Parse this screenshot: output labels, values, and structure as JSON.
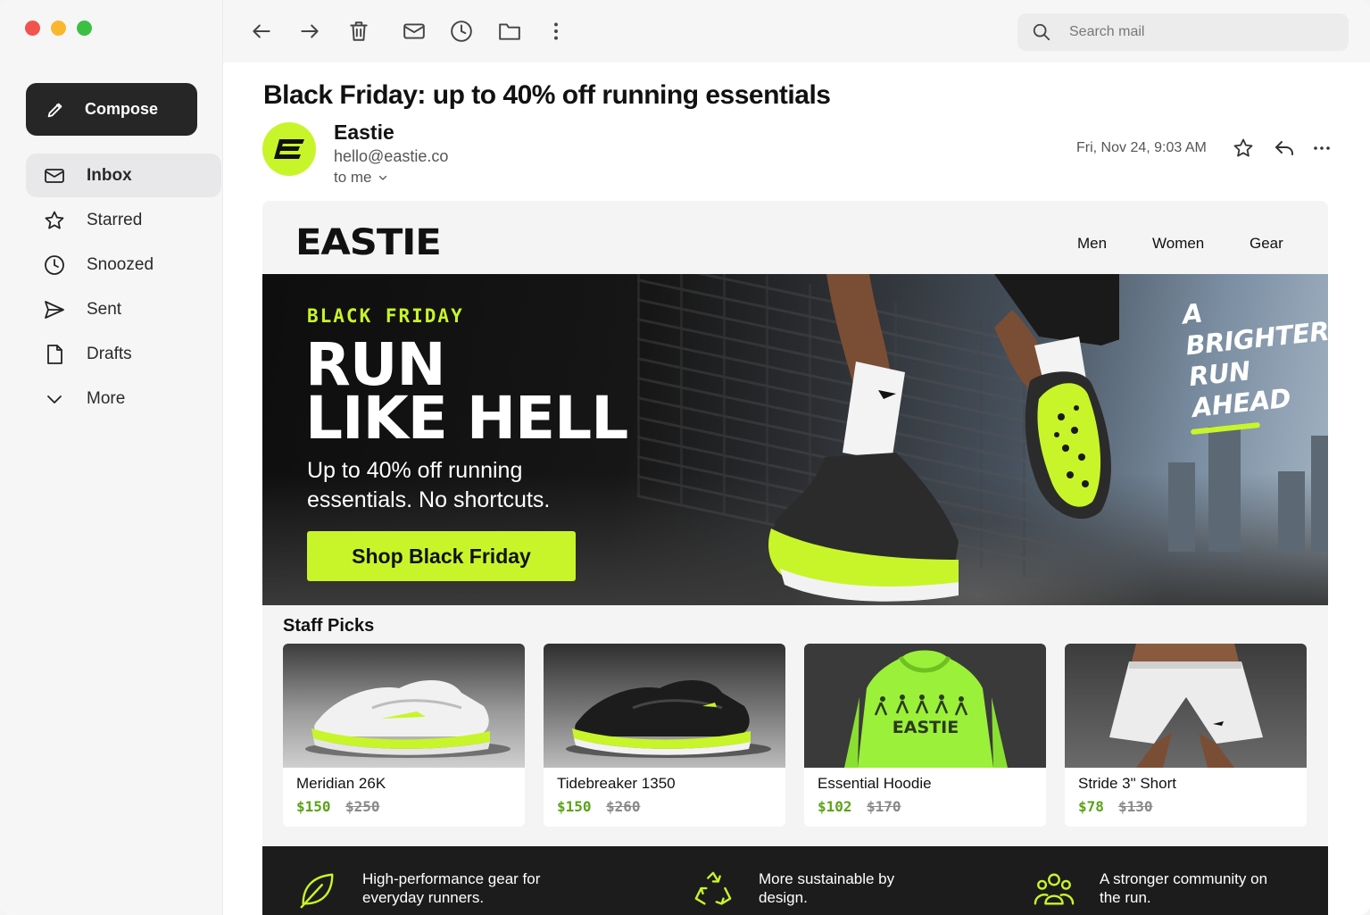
{
  "sidebar": {
    "compose_label": "Compose",
    "items": [
      {
        "label": "Inbox",
        "icon": "inbox-icon"
      },
      {
        "label": "Starred",
        "icon": "star-icon"
      },
      {
        "label": "Snoozed",
        "icon": "clock-icon"
      },
      {
        "label": "Sent",
        "icon": "send-icon"
      },
      {
        "label": "Drafts",
        "icon": "draft-icon"
      },
      {
        "label": "More",
        "icon": "chevron-down-icon"
      }
    ]
  },
  "toolbar": {
    "icons": [
      "back-arrow-icon",
      "forward-arrow-icon",
      "trash-icon",
      "mail-icon",
      "clock-icon",
      "folder-icon",
      "more-vert-icon"
    ],
    "search_placeholder": "Search mail"
  },
  "message": {
    "subject": "Black Friday: up to 40% off running essentials",
    "sender_name": "Eastie",
    "sender_email": "hello@eastie.co",
    "recipient": "to me",
    "date": "Fri, Nov 24, 9:03 AM",
    "avatar_letter": "E"
  },
  "email": {
    "brand": "EASTIE",
    "nav": [
      "Men",
      "Women",
      "Gear"
    ],
    "hero": {
      "eyebrow": "BLACK FRIDAY",
      "headline_line1": "RUN",
      "headline_line2": "LIKE HELL",
      "subhead": "Up to 40% off running essentials. No shortcuts.",
      "cta": "Shop Black Friday",
      "tagline_lines": [
        "A",
        "BRIGHTER",
        "RUN",
        "AHEAD"
      ]
    },
    "picks_title": "Staff Picks",
    "products": [
      {
        "name": "Meridian 26K",
        "price": "$150",
        "was": "$250"
      },
      {
        "name": "Tidebreaker 1350",
        "price": "$150",
        "was": "$260"
      },
      {
        "name": "Essential Hoodie",
        "price": "$102",
        "was": "$170"
      },
      {
        "name": "Stride 3\" Short",
        "price": "$78",
        "was": "$130"
      }
    ],
    "hoodie_print": "EASTIE",
    "values": [
      {
        "text": "High-performance gear for everyday runners.",
        "icon": "leaf-icon"
      },
      {
        "text": "More sustainable by design.",
        "icon": "recycle-icon"
      },
      {
        "text": "A stronger community on the run.",
        "icon": "community-icon"
      }
    ]
  },
  "colors": {
    "accent": "#c8f52a",
    "compose_bg": "#262626",
    "price_green": "#5aa317"
  }
}
